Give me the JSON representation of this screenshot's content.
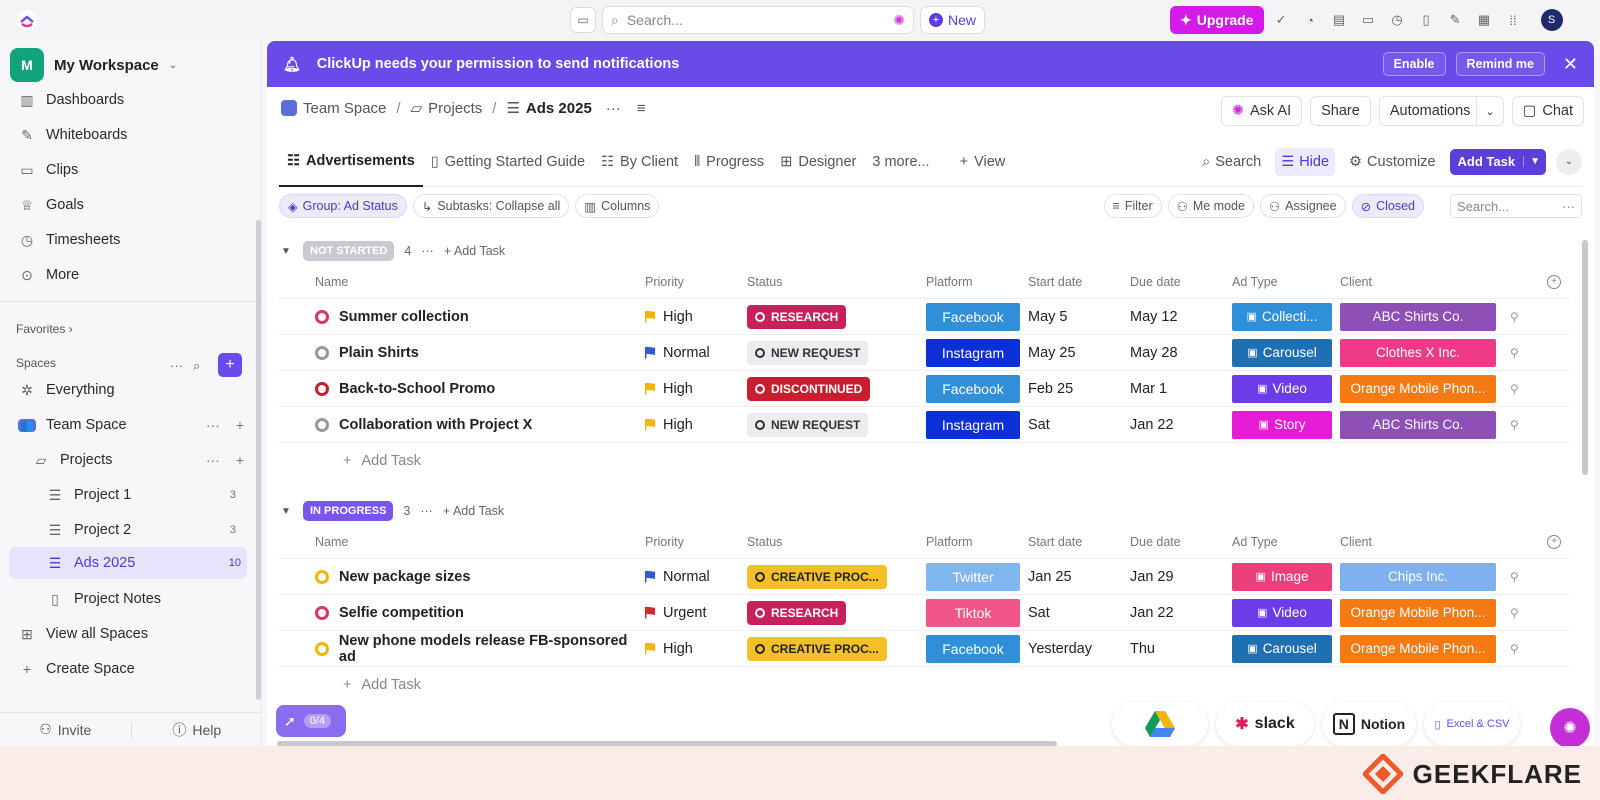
{
  "topbar": {
    "search_placeholder": "Search...",
    "new_label": "New",
    "upgrade_label": "Upgrade",
    "avatar_initial": "S"
  },
  "sidebar": {
    "workspace_initial": "M",
    "workspace_name": "My Workspace",
    "nav": [
      {
        "label": "Dashboards",
        "icon": "dashboard-icon"
      },
      {
        "label": "Whiteboards",
        "icon": "whiteboard-icon"
      },
      {
        "label": "Clips",
        "icon": "clips-icon"
      },
      {
        "label": "Goals",
        "icon": "goals-icon"
      },
      {
        "label": "Timesheets",
        "icon": "timesheets-icon"
      },
      {
        "label": "More",
        "icon": "more-icon"
      }
    ],
    "favorites_label": "Favorites",
    "spaces_label": "Spaces",
    "everything": "Everything",
    "team_space": "Team Space",
    "projects": "Projects",
    "lists": [
      {
        "label": "Project 1",
        "count": "3"
      },
      {
        "label": "Project 2",
        "count": "3"
      },
      {
        "label": "Ads 2025",
        "count": "10"
      }
    ],
    "project_notes": "Project Notes",
    "view_all": "View all Spaces",
    "create_space": "Create Space",
    "invite": "Invite",
    "help": "Help"
  },
  "banner": {
    "text": "ClickUp needs your permission to send notifications",
    "enable": "Enable",
    "remind": "Remind me"
  },
  "breadcrumb": {
    "space": "Team Space",
    "folder": "Projects",
    "list": "Ads 2025"
  },
  "header": {
    "ask_ai": "Ask AI",
    "share": "Share",
    "automations": "Automations",
    "chat": "Chat"
  },
  "tabs": {
    "items": [
      "Advertisements",
      "Getting Started Guide",
      "By Client",
      "Progress",
      "Designer"
    ],
    "more": "3 more...",
    "view": "View",
    "search": "Search",
    "hide": "Hide",
    "customize": "Customize",
    "add_task": "Add Task"
  },
  "filters": {
    "group": "Group: Ad Status",
    "subtasks": "Subtasks: Collapse all",
    "columns": "Columns",
    "filter": "Filter",
    "me_mode": "Me mode",
    "assignee": "Assignee",
    "closed": "Closed",
    "search_placeholder": "Search..."
  },
  "columns": {
    "name": "Name",
    "priority": "Priority",
    "status": "Status",
    "platform": "Platform",
    "start": "Start date",
    "due": "Due date",
    "ad_type": "Ad Type",
    "client": "Client"
  },
  "groups": [
    {
      "label": "NOT STARTED",
      "count": "4",
      "add_task": "Add Task",
      "tasks": [
        {
          "name": "Summer collection",
          "dot": "#d6336c",
          "priority": "High",
          "pri_color": "#f5b400",
          "status": "RESEARCH",
          "status_bg": "#c8205a",
          "status_fg": "#ffffff",
          "platform": "Facebook",
          "plat_bg": "#2f8fd8",
          "start": "May 5",
          "due": "May 12",
          "ad_type": "Collecti...",
          "at_bg": "#2f8fd8",
          "client": "ABC Shirts Co.",
          "cl_bg": "#8e4fb6"
        },
        {
          "name": "Plain Shirts",
          "dot": "#999999",
          "priority": "Normal",
          "pri_color": "#3557d6",
          "status": "NEW REQUEST",
          "status_bg": "#ececee",
          "status_fg": "#333333",
          "platform": "Instagram",
          "plat_bg": "#0c2fd6",
          "start": "May 25",
          "due": "May 28",
          "ad_type": "Carousel",
          "at_bg": "#1f6fb3",
          "client": "Clothes X Inc.",
          "cl_bg": "#f03a88"
        },
        {
          "name": "Back-to-School Promo",
          "dot": "#c81e2d",
          "priority": "High",
          "pri_color": "#f5b400",
          "status": "DISCONTINUED",
          "status_bg": "#c81e2d",
          "status_fg": "#ffffff",
          "platform": "Facebook",
          "plat_bg": "#2f8fd8",
          "start": "Feb 25",
          "due": "Mar 1",
          "ad_type": "Video",
          "at_bg": "#6a3de8",
          "client": "Orange Mobile Phon...",
          "cl_bg": "#f57a12"
        },
        {
          "name": "Collaboration with Project X",
          "dot": "#999999",
          "priority": "High",
          "pri_color": "#f5b400",
          "status": "NEW REQUEST",
          "status_bg": "#ececee",
          "status_fg": "#333333",
          "platform": "Instagram",
          "plat_bg": "#0c2fd6",
          "start": "Sat",
          "due": "Jan 22",
          "ad_type": "Story",
          "at_bg": "#e61bd6",
          "client": "ABC Shirts Co.",
          "cl_bg": "#8e4fb6"
        }
      ]
    },
    {
      "label": "IN PROGRESS",
      "count": "3",
      "add_task": "Add Task",
      "tasks": [
        {
          "name": "New package sizes",
          "dot": "#f2b705",
          "priority": "Normal",
          "pri_color": "#3557d6",
          "status": "CREATIVE PROC...",
          "status_bg": "#f5c027",
          "status_fg": "#222222",
          "platform": "Twitter",
          "plat_bg": "#7fb6ef",
          "start": "Jan 25",
          "due": "Jan 29",
          "ad_type": "Image",
          "at_bg": "#ea3f7a",
          "client": "Chips Inc.",
          "cl_bg": "#7fb0ef"
        },
        {
          "name": "Selfie competition",
          "dot": "#d6336c",
          "priority": "Urgent",
          "pri_color": "#d12a2a",
          "status": "RESEARCH",
          "status_bg": "#c8205a",
          "status_fg": "#ffffff",
          "platform": "Tiktok",
          "plat_bg": "#f0568a",
          "start": "Sat",
          "due": "Jan 22",
          "ad_type": "Video",
          "at_bg": "#6a3de8",
          "client": "Orange Mobile Phon...",
          "cl_bg": "#f57a12"
        },
        {
          "name": "New phone models release FB-sponsored ad",
          "dot": "#f2b705",
          "priority": "High",
          "pri_color": "#f5b400",
          "status": "CREATIVE PROC...",
          "status_bg": "#f5c027",
          "status_fg": "#222222",
          "platform": "Facebook",
          "plat_bg": "#2f8fd8",
          "start": "Yesterday",
          "due": "Thu",
          "ad_type": "Carousel",
          "at_bg": "#1f6fb3",
          "client": "Orange Mobile Phon...",
          "cl_bg": "#f57a12"
        }
      ]
    }
  ],
  "bottom": {
    "rocket_count": "0/4",
    "integrations": [
      "slack",
      "Notion",
      "Excel & CSV"
    ],
    "brand": "GEEKFLARE"
  }
}
